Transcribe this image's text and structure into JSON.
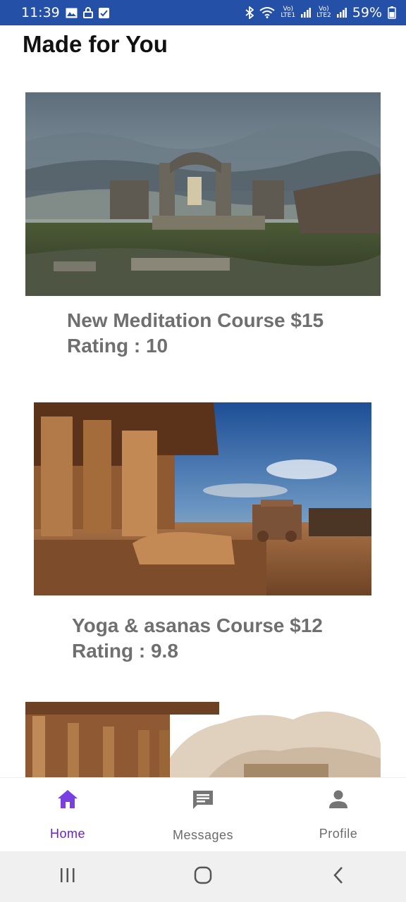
{
  "status_bar": {
    "time": "11:39",
    "battery": "59%",
    "sim1_top": "Vo)",
    "sim1_bottom": "LTE1",
    "sim2_top": "Vo)",
    "sim2_bottom": "LTE2"
  },
  "page": {
    "title": "Made for You"
  },
  "courses": [
    {
      "title": "New Meditation Course $15",
      "rating": "Rating : 10",
      "image": "temple-ruins-mountains"
    },
    {
      "title": "Yoga & asanas Course $12",
      "rating": "Rating : 9.8",
      "image": "carved-temple-stone-chariot"
    },
    {
      "title": "",
      "rating": "",
      "image": "temple-pillars-boulders"
    }
  ],
  "bottom_nav": {
    "items": [
      {
        "label": "Home",
        "icon": "home-icon",
        "active": true
      },
      {
        "label": "Messages",
        "icon": "message-icon",
        "active": false
      },
      {
        "label": "Profile",
        "icon": "person-icon",
        "active": false
      }
    ],
    "active_color": "#6a1fc9"
  },
  "colors": {
    "status_bar": "#2450a8",
    "card_text": "#6f6f6f",
    "inactive_nav": "#6b6b6b"
  }
}
